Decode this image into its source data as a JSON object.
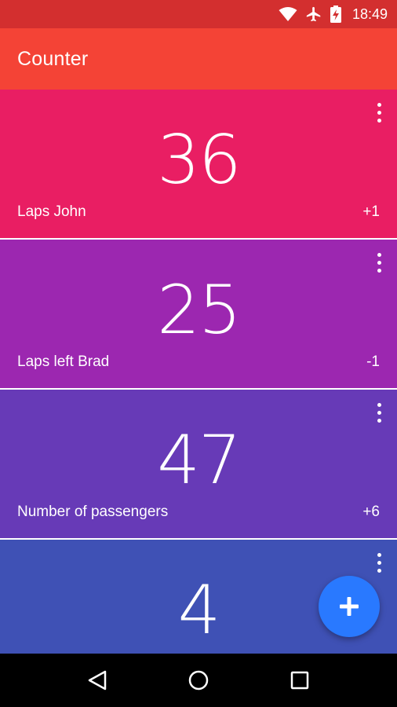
{
  "status_bar": {
    "time": "18:49",
    "icons": [
      "wifi-icon",
      "airplane-mode-icon",
      "battery-charging-icon"
    ]
  },
  "app_bar": {
    "title": "Counter",
    "color": "#f44336"
  },
  "counters": [
    {
      "value": "36",
      "label": "Laps John",
      "step": "+1",
      "color": "#e91e63"
    },
    {
      "value": "25",
      "label": "Laps left Brad",
      "step": "-1",
      "color": "#9c27b0"
    },
    {
      "value": "47",
      "label": "Number of passengers",
      "step": "+6",
      "color": "#673ab7"
    },
    {
      "value": "4",
      "label": "",
      "step": "",
      "color": "#3f51b5"
    }
  ],
  "fab": {
    "icon": "plus-icon",
    "color": "#2979ff"
  },
  "nav_bar": {
    "icons": [
      "back-icon",
      "home-icon",
      "recents-icon"
    ]
  }
}
